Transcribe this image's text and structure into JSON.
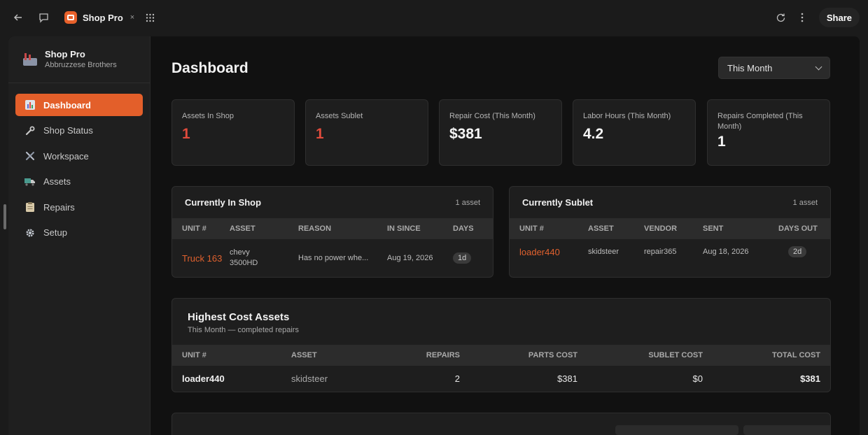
{
  "topbar": {
    "back_icon": "arrow-left-icon",
    "chat_icon": "chat-icon",
    "app_tab_title": "Shop Pro",
    "close_glyph": "×",
    "apps_icon": "grid-icon",
    "refresh_icon": "refresh-icon",
    "more_icon": "more-vertical-icon",
    "share_label": "Share"
  },
  "sidebar": {
    "brand_title": "Shop Pro",
    "brand_subtitle": "Abbruzzese Brothers",
    "items": [
      {
        "label": "Dashboard",
        "icon": "chart-icon",
        "active": true
      },
      {
        "label": "Shop Status",
        "icon": "wrench-icon",
        "active": false
      },
      {
        "label": "Workspace",
        "icon": "tools-icon",
        "active": false
      },
      {
        "label": "Assets",
        "icon": "truck-icon",
        "active": false
      },
      {
        "label": "Repairs",
        "icon": "clipboard-icon",
        "active": false
      },
      {
        "label": "Setup",
        "icon": "gear-icon",
        "active": false
      }
    ]
  },
  "main": {
    "title": "Dashboard",
    "range_select": {
      "value": "This Month"
    },
    "stats": [
      {
        "label": "Assets In Shop",
        "value": "1"
      },
      {
        "label": "Assets Sublet",
        "value": "1"
      },
      {
        "label": "Repair Cost (This Month)",
        "value": "$381"
      },
      {
        "label": "Labor Hours (This Month)",
        "value": "4.2"
      },
      {
        "label": "Repairs Completed (This Month)",
        "value": "1"
      }
    ],
    "in_shop": {
      "title": "Currently In Shop",
      "count": "1 asset",
      "columns": [
        "UNIT #",
        "ASSET",
        "REASON",
        "IN SINCE",
        "DAYS"
      ],
      "rows": [
        {
          "unit": "Truck 163",
          "asset": "chevy 3500HD",
          "reason": "Has no power whe...",
          "in_since": "Aug 19, 2026",
          "days": "1d"
        }
      ]
    },
    "sublet": {
      "title": "Currently Sublet",
      "count": "1 asset",
      "columns": [
        "UNIT #",
        "ASSET",
        "VENDOR",
        "SENT",
        "DAYS OUT"
      ],
      "rows": [
        {
          "unit": "loader440",
          "asset": "skidsteer",
          "vendor": "repair365",
          "sent": "Aug 18, 2026",
          "days_out": "2d"
        }
      ]
    },
    "highest_cost": {
      "title": "Highest Cost Assets",
      "subtitle": "This Month — completed repairs",
      "columns": [
        "UNIT #",
        "ASSET",
        "REPAIRS",
        "PARTS COST",
        "SUBLET COST",
        "TOTAL COST"
      ],
      "rows": [
        {
          "unit": "loader440",
          "asset": "skidsteer",
          "repairs": "2",
          "parts_cost": "$381",
          "sublet_cost": "$0",
          "total_cost": "$381"
        }
      ]
    }
  },
  "colors": {
    "accent": "#e35f2a",
    "alert_red": "#e04b3c",
    "background": "#111111",
    "panel": "#1e1e1e"
  }
}
